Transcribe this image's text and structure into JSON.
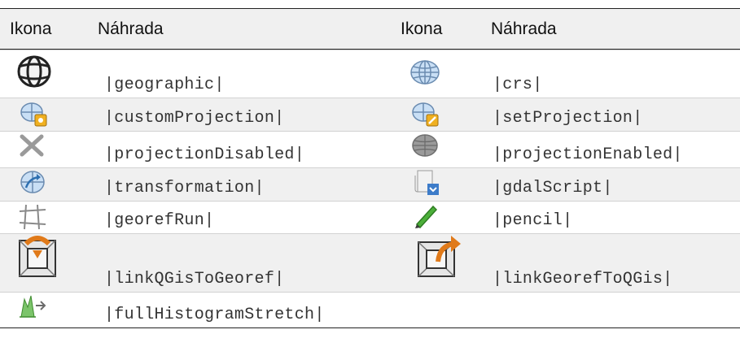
{
  "table": {
    "headers": [
      "Ikona",
      "Náhrada",
      "Ikona",
      "Náhrada"
    ],
    "rows": [
      {
        "left": {
          "icon": "globe-outline-icon",
          "text": "|geographic|"
        },
        "right": {
          "icon": "crs-globe-icon",
          "text": "|crs|"
        }
      },
      {
        "left": {
          "icon": "custom-projection-icon",
          "text": "|customProjection|"
        },
        "right": {
          "icon": "set-projection-icon",
          "text": "|setProjection|"
        }
      },
      {
        "left": {
          "icon": "projection-disabled-icon",
          "text": "|projectionDisabled|"
        },
        "right": {
          "icon": "projection-enabled-icon",
          "text": "|projectionEnabled|"
        }
      },
      {
        "left": {
          "icon": "transformation-icon",
          "text": "|transformation|"
        },
        "right": {
          "icon": "gdal-script-icon",
          "text": "|gdalScript|"
        }
      },
      {
        "left": {
          "icon": "georef-run-icon",
          "text": "|georefRun|"
        },
        "right": {
          "icon": "pencil-icon",
          "text": "|pencil|"
        }
      },
      {
        "left": {
          "icon": "link-qgis-to-georef-icon",
          "text": "|linkQGisToGeoref|"
        },
        "right": {
          "icon": "link-georef-to-qgis-icon",
          "text": "|linkGeorefToQGis|"
        }
      },
      {
        "left": {
          "icon": "full-histogram-stretch-icon",
          "text": "|fullHistogramStretch|"
        },
        "right": null
      }
    ]
  }
}
